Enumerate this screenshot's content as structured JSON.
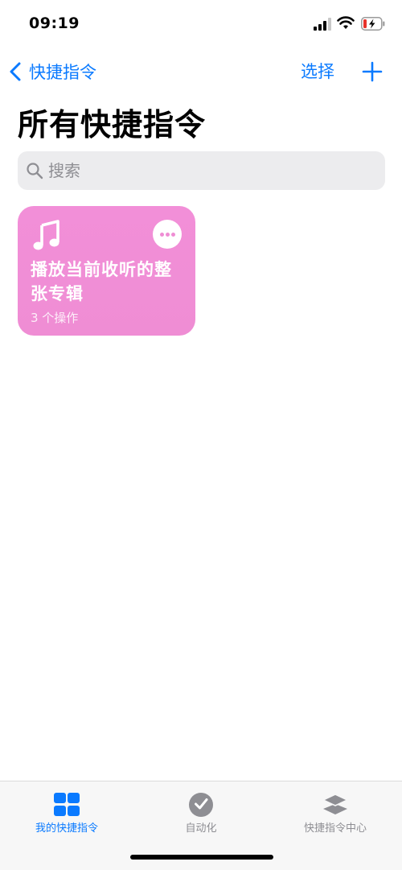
{
  "status_bar": {
    "time": "09:19"
  },
  "nav": {
    "back_label": "快捷指令",
    "select_label": "选择"
  },
  "page_title": "所有快捷指令",
  "search": {
    "placeholder": "搜索"
  },
  "shortcuts": [
    {
      "title": "播放当前收听的整张专辑",
      "subtitle": "3 个操作",
      "color": "#ef8dd4",
      "icon": "music-note-icon"
    }
  ],
  "tabs": [
    {
      "label": "我的快捷指令",
      "icon": "grid-icon",
      "active": true
    },
    {
      "label": "自动化",
      "icon": "clock-check-icon",
      "active": false
    },
    {
      "label": "快捷指令中心",
      "icon": "layers-icon",
      "active": false
    }
  ],
  "colors": {
    "accent": "#0a7aff",
    "card": "#ef8dd4",
    "battery_low": "#e8322b"
  }
}
